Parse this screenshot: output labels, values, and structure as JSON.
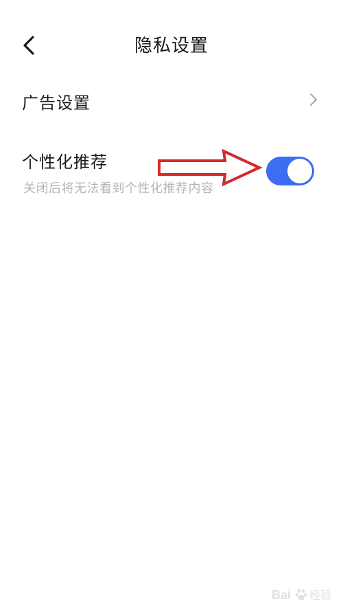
{
  "header": {
    "title": "隐私设置",
    "back_icon": "chevron-left-icon"
  },
  "rows": {
    "ad_settings": {
      "label": "广告设置",
      "icon": "chevron-right-icon"
    },
    "personalized_recommendation": {
      "label": "个性化推荐",
      "description": "关闭后将无法看到个性化推荐内容",
      "toggle_on": true
    }
  },
  "colors": {
    "accent": "#3d6df2",
    "text_primary": "#1a1a1a",
    "text_secondary": "#b5b5b5",
    "annotation": "#d42a2a"
  },
  "annotation": {
    "icon": "red-arrow-icon"
  },
  "watermark": {
    "text": "Baidu经验",
    "icon": "baidu-paw-icon"
  }
}
